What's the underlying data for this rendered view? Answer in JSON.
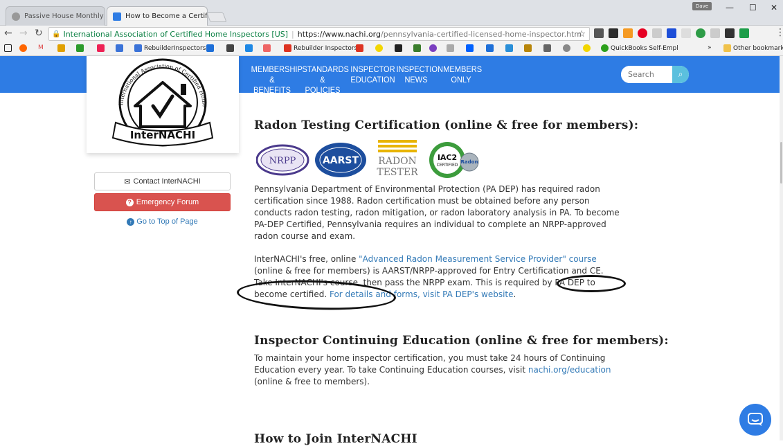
{
  "browser": {
    "tabs": [
      {
        "title": "Passive House Monthly M",
        "active": false
      },
      {
        "title": "How to Become a Certifi",
        "active": true
      }
    ],
    "profile_label": "Dave",
    "omnibox": {
      "org": "International Association of Certified Home Inspectors [US]",
      "url_host": "https://www.nachi.org",
      "url_path": "/pennsylvania-certified-licensed-home-inspector.htm"
    },
    "bookmarks": [
      "RebuilderInspectors",
      "Rebuilder Inspectors",
      "QuickBooks Self-Empl",
      "Other bookmarks"
    ]
  },
  "site": {
    "logo_text": "InterNACHI",
    "logo_ring_text": "International Association of Certified Home Inspectors",
    "nav": [
      {
        "line1": "Membership",
        "line2": "& Benefits"
      },
      {
        "line1": "Standards",
        "line2": "& Policies"
      },
      {
        "line1": "Inspector",
        "line2": "Education"
      },
      {
        "line1": "Inspection",
        "line2": "News"
      },
      {
        "line1": "Members",
        "line2": "Only"
      }
    ],
    "search_placeholder": "Search"
  },
  "sidebar": {
    "contact_label": "Contact InterNACHI",
    "emergency_label": "Emergency Forum",
    "top_label": "Go to Top of Page"
  },
  "main": {
    "radon_heading": "Radon Testing Certification (online & free for members):",
    "radon_logos": [
      "NRPP",
      "AARST",
      "RADON",
      "TESTER",
      "IAC2",
      "CERTIFIED",
      "Radon"
    ],
    "radon_p1": "Pennsylvania Department of Environmental Protection (PA DEP) has required radon certification since 1988. Radon certification must be obtained before any person conducts radon testing, radon mitigation, or radon laboratory analysis in PA. To become PA-DEP Certified, Pennsylvania requires an individual to complete an NRPP-approved radon course and exam.",
    "radon_p2_a": "InterNACHI's free, online ",
    "radon_p2_link": "\"Advanced Radon Measurement Service Provider\" course",
    "radon_p2_b": " (online & free for members) is AARST/NRPP-approved for Entry Certification and CE. Take InterNACHI's course, then pass the NRPP exam. This is required by PA DEP to become certified. ",
    "radon_p2_link2": "For details and forms, visit PA DEP's website",
    "radon_p2_end": ".",
    "ce_heading": "Inspector Continuing Education (online & free for members):",
    "ce_p_a": "To maintain your home inspector certification, you must take 24 hours of Continuing Education every year. To take Continuing Education courses, visit ",
    "ce_p_link": "nachi.org/education",
    "ce_p_b": " (online & free to members).",
    "join_heading": "How to Join InterNACHI"
  },
  "colors": {
    "header_blue": "#2e7ce4",
    "emergency_red": "#d9534f",
    "link_blue": "#337ab7"
  }
}
